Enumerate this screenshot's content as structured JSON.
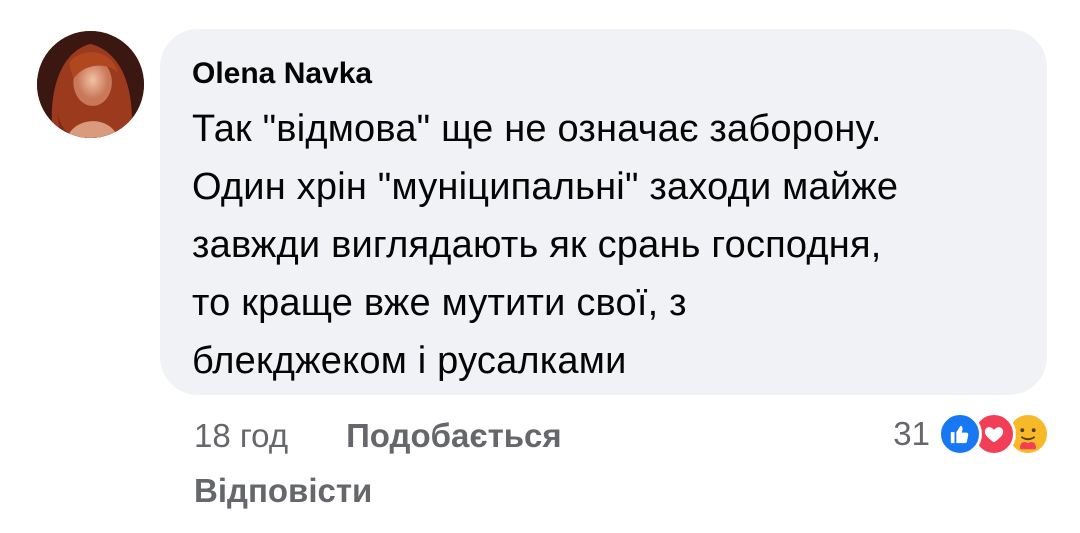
{
  "comment": {
    "author": "Olena Navka",
    "text": "Так \"відмова\" ще не означає заборону.\nОдин хрін \"муніципальні\" заходи майже\nзавжди виглядають як срань господня,\nто краще вже мутити свої, з\nблекджеком і русалками",
    "timestamp": "18 год",
    "like_label": "Подобається",
    "reply_label": "Відповісти",
    "reaction_count": "31",
    "reaction_icons": [
      "like-icon",
      "love-icon",
      "care-icon"
    ]
  },
  "colors": {
    "bubble_bg": "#f0f2f5",
    "meta_text": "#65676b",
    "like_blue": "#1877f2",
    "love_red": "#f33e58",
    "care_yellow": "#f7b928"
  }
}
